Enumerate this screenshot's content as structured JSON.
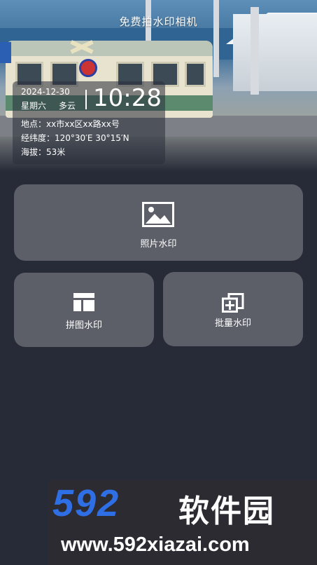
{
  "header": {
    "title": "免费拍水印相机"
  },
  "watermark_card": {
    "date": "2024-12-30",
    "weekday": "星期六",
    "weather": "多云",
    "time": "10:28",
    "location_label": "地点：",
    "location_value": "xx市xx区xx路xx号",
    "coords_label": "经纬度：",
    "coords_value": "120°30′E 30°15′N",
    "altitude_label": "海拔：",
    "altitude_value": "53米"
  },
  "tiles": {
    "photo": {
      "label": "照片水印",
      "icon": "image-icon"
    },
    "collage": {
      "label": "拼图水印",
      "icon": "layout-icon"
    },
    "batch": {
      "label": "批量水印",
      "icon": "batch-add-icon"
    }
  },
  "branding": {
    "number": "592",
    "name": "软件园",
    "url": "www.592xiazai.com",
    "number_color": "#2f6fe6"
  },
  "colors": {
    "background": "#262b37",
    "tile": "#5c5f68"
  }
}
